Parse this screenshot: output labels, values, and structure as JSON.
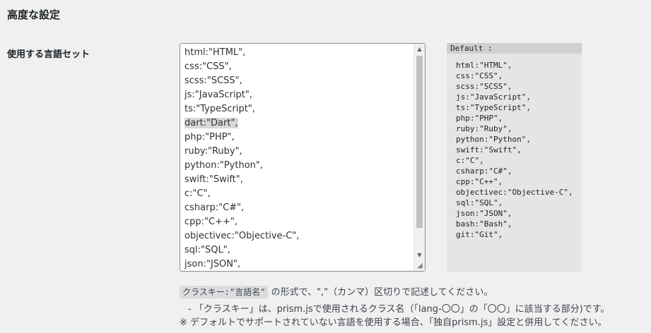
{
  "section": {
    "title": "高度な設定"
  },
  "field": {
    "label": "使用する言語セット"
  },
  "editor": {
    "lines": [
      "html:\"HTML\",",
      "css:\"CSS\",",
      "scss:\"SCSS\",",
      "js:\"JavaScript\",",
      "ts:\"TypeScript\",",
      "dart:\"Dart\",",
      "php:\"PHP\",",
      "ruby:\"Ruby\",",
      "python:\"Python\",",
      "swift:\"Swift\",",
      "c:\"C\",",
      "csharp:\"C#\",",
      "cpp:\"C++\",",
      "objectivec:\"Objective-C\",",
      "sql:\"SQL\",",
      "json:\"JSON\","
    ],
    "highlighted_line": 5
  },
  "defaults": {
    "heading": "Default :",
    "lines": [
      "html:\"HTML\",",
      "css:\"CSS\",",
      "scss:\"SCSS\",",
      "js:\"JavaScript\",",
      "ts:\"TypeScript\",",
      "php:\"PHP\",",
      "ruby:\"Ruby\",",
      "python:\"Python\",",
      "swift:\"Swift\",",
      "c:\"C\",",
      "csharp:\"C#\",",
      "cpp:\"C++\",",
      "objectivec:\"Objective-C\",",
      "sql:\"SQL\",",
      "json:\"JSON\",",
      "bash:\"Bash\",",
      "git:\"Git\","
    ]
  },
  "description": {
    "format_code": "クラスキー:\"言語名\"",
    "format_text": " の形式で、\",\"（カンマ）区切りで記述してください。",
    "note_1": "- 「クラスキー」は、prism.jsで使用されるクラス名（「lang-〇〇」の「〇〇」に該当する部分)です。",
    "note_2": "※ デフォルトでサポートされていない言語を使用する場合、「独自prism.js」設定と併用してください。"
  }
}
